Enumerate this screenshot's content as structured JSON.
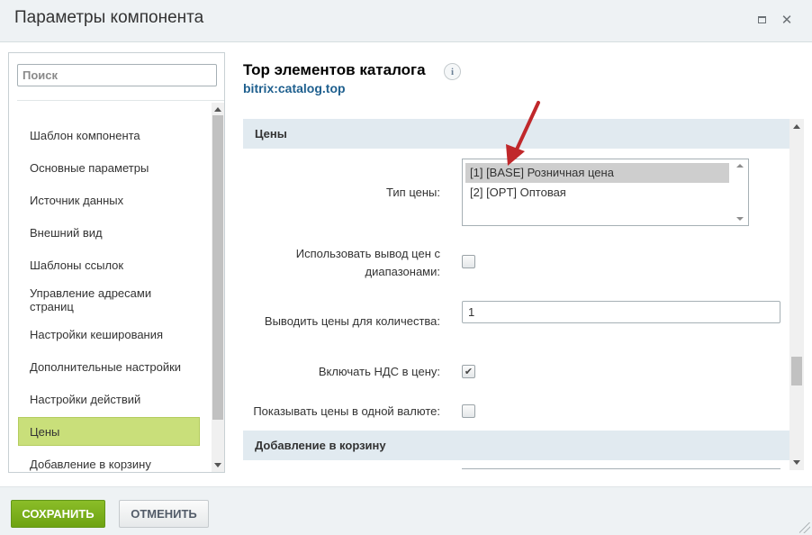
{
  "window": {
    "title": "Параметры компонента"
  },
  "sidebar": {
    "search_placeholder": "Поиск",
    "items": [
      {
        "label": "Шаблон компонента"
      },
      {
        "label": "Основные параметры"
      },
      {
        "label": "Источник данных"
      },
      {
        "label": "Внешний вид"
      },
      {
        "label": "Шаблоны ссылок"
      },
      {
        "label": "Управление адресами страниц"
      },
      {
        "label": "Настройки кеширования"
      },
      {
        "label": "Дополнительные настройки"
      },
      {
        "label": "Настройки действий"
      },
      {
        "label": "Цены",
        "active": true
      },
      {
        "label": "Добавление в корзину"
      }
    ]
  },
  "component": {
    "title": "Top элементов каталога",
    "info_icon": "i",
    "code": "bitrix:catalog.top"
  },
  "sections": {
    "prices": {
      "title": "Цены",
      "price_type": {
        "label": "Тип цены:",
        "options": [
          {
            "label": "[1] [BASE] Розничная цена",
            "selected": true
          },
          {
            "label": "[2] [OPT] Оптовая",
            "selected": false
          }
        ]
      },
      "use_ranges": {
        "label": "Использовать вывод цен с диапазонами:",
        "checked": false
      },
      "price_quantity": {
        "label": "Выводить цены для количества:",
        "value": "1"
      },
      "include_vat": {
        "label": "Включать НДС в цену:",
        "checked": true
      },
      "one_currency": {
        "label": "Показывать цены в одной валюте:",
        "checked": false
      }
    },
    "basket": {
      "title": "Добавление в корзину"
    }
  },
  "footer": {
    "save_label": "СОХРАНИТЬ",
    "cancel_label": "ОТМЕНИТЬ"
  },
  "colors": {
    "active_item": "#c9df7a",
    "save_button": "#7ab020",
    "section_header": "#e1eaf0",
    "link": "#1e5f8e",
    "annotation_arrow": "#c0282b"
  }
}
